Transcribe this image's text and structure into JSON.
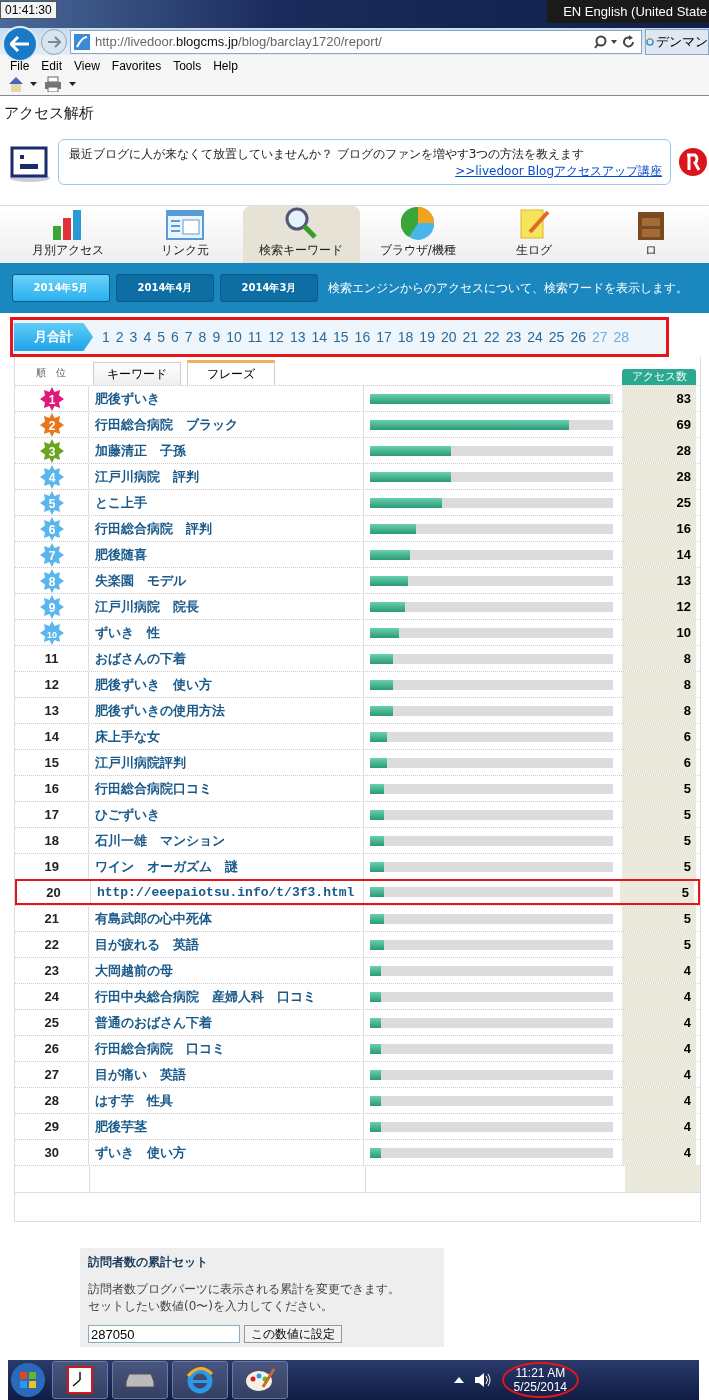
{
  "system_clock": "01:41:30",
  "language_bar": "EN English (United State",
  "address_bar": {
    "url_start": "http://livedoor.",
    "url_domain": "blogcms.jp",
    "url_end": "/blog/barclay1720/report/",
    "tab_title": "デンマン"
  },
  "menu": [
    "File",
    "Edit",
    "View",
    "Favorites",
    "Tools",
    "Help"
  ],
  "page_title": "アクセス解析",
  "banner": {
    "message": "最近ブログに人が来なくて放置していませんか？ ブログのファンを増やす3つの方法を教えます",
    "link": ">>livedoor Blogアクセスアップ講座"
  },
  "nav_tabs": [
    {
      "label": "月別アクセス",
      "selected": false,
      "kind": "bars"
    },
    {
      "label": "リンク元",
      "selected": false,
      "kind": "window"
    },
    {
      "label": "検索キーワード",
      "selected": true,
      "kind": "search"
    },
    {
      "label": "ブラウザ/機種",
      "selected": false,
      "kind": "pie"
    },
    {
      "label": "生ログ",
      "selected": false,
      "kind": "note"
    },
    {
      "label": "ロ",
      "selected": false,
      "kind": "cabinet"
    }
  ],
  "month_tabs": [
    {
      "label": "2014年5月",
      "selected": true
    },
    {
      "label": "2014年4月",
      "selected": false
    },
    {
      "label": "2014年3月",
      "selected": false
    }
  ],
  "month_description": "検索エンジンからのアクセスについて、検索ワードを表示します。",
  "day_selector": {
    "highlighted": true,
    "total_label": "月合計",
    "total_selected": true,
    "days": [
      {
        "label": "1",
        "disabled": false
      },
      {
        "label": "2",
        "disabled": false
      },
      {
        "label": "3",
        "disabled": false
      },
      {
        "label": "4",
        "disabled": false
      },
      {
        "label": "5",
        "disabled": false
      },
      {
        "label": "6",
        "disabled": false
      },
      {
        "label": "7",
        "disabled": false
      },
      {
        "label": "8",
        "disabled": false
      },
      {
        "label": "9",
        "disabled": false
      },
      {
        "label": "10",
        "disabled": false
      },
      {
        "label": "11",
        "disabled": false
      },
      {
        "label": "12",
        "disabled": false
      },
      {
        "label": "13",
        "disabled": false
      },
      {
        "label": "14",
        "disabled": false
      },
      {
        "label": "15",
        "disabled": false
      },
      {
        "label": "16",
        "disabled": false
      },
      {
        "label": "17",
        "disabled": false
      },
      {
        "label": "18",
        "disabled": false
      },
      {
        "label": "19",
        "disabled": false
      },
      {
        "label": "20",
        "disabled": false
      },
      {
        "label": "21",
        "disabled": false
      },
      {
        "label": "22",
        "disabled": false
      },
      {
        "label": "23",
        "disabled": false
      },
      {
        "label": "24",
        "disabled": false
      },
      {
        "label": "25",
        "disabled": false
      },
      {
        "label": "26",
        "disabled": false
      },
      {
        "label": "27",
        "disabled": true
      },
      {
        "label": "28",
        "disabled": true
      }
    ]
  },
  "table": {
    "rank_header": "順　位",
    "count_header": "アクセス数",
    "view_tabs": [
      {
        "label": "キーワード",
        "selected": false
      },
      {
        "label": "フレーズ",
        "selected": true
      }
    ],
    "rows": [
      {
        "rank": "1",
        "color": "#e0187c",
        "phrase": "肥後ずいき",
        "level": 1.0,
        "count": "83",
        "highlighted": false
      },
      {
        "rank": "2",
        "color": "#e8761e",
        "phrase": "行田総合病院　ブラック",
        "level": 0.831,
        "count": "69",
        "highlighted": false
      },
      {
        "rank": "3",
        "color": "#6aa421",
        "phrase": "加藤清正　子孫",
        "level": 0.337,
        "count": "28",
        "highlighted": false
      },
      {
        "rank": "4",
        "color": "#5cb6ee",
        "phrase": "江戸川病院　評判",
        "level": 0.337,
        "count": "28",
        "highlighted": false
      },
      {
        "rank": "5",
        "color": "#5cb6ee",
        "phrase": "とこ上手",
        "level": 0.301,
        "count": "25",
        "highlighted": false
      },
      {
        "rank": "6",
        "color": "#5cb6ee",
        "phrase": "行田総合病院　評判",
        "level": 0.193,
        "count": "16",
        "highlighted": false
      },
      {
        "rank": "7",
        "color": "#5cb6ee",
        "phrase": "肥後随喜",
        "level": 0.169,
        "count": "14",
        "highlighted": false
      },
      {
        "rank": "8",
        "color": "#5cb6ee",
        "phrase": "失楽園　モデル",
        "level": 0.157,
        "count": "13",
        "highlighted": false
      },
      {
        "rank": "9",
        "color": "#5cb6ee",
        "phrase": "江戸川病院　院長",
        "level": 0.145,
        "count": "12",
        "highlighted": false
      },
      {
        "rank": "10",
        "color": "#5cb6ee",
        "phrase": "ずいき　性",
        "level": 0.12,
        "count": "10",
        "highlighted": false
      },
      {
        "rank": "11",
        "phrase": "おばさんの下着",
        "level": 0.096,
        "count": "8",
        "highlighted": false
      },
      {
        "rank": "12",
        "phrase": "肥後ずいき　使い方",
        "level": 0.096,
        "count": "8",
        "highlighted": false
      },
      {
        "rank": "13",
        "phrase": "肥後ずいきの使用方法",
        "level": 0.096,
        "count": "8",
        "highlighted": false
      },
      {
        "rank": "14",
        "phrase": "床上手な女",
        "level": 0.072,
        "count": "6",
        "highlighted": false
      },
      {
        "rank": "15",
        "phrase": "江戸川病院評判",
        "level": 0.072,
        "count": "6",
        "highlighted": false
      },
      {
        "rank": "16",
        "phrase": "行田総合病院口コミ",
        "level": 0.06,
        "count": "5",
        "highlighted": false
      },
      {
        "rank": "17",
        "phrase": "ひごずいき",
        "level": 0.06,
        "count": "5",
        "highlighted": false
      },
      {
        "rank": "18",
        "phrase": "石川一雄　マンション",
        "level": 0.06,
        "count": "5",
        "highlighted": false
      },
      {
        "rank": "19",
        "phrase": "ワイン　オーガズム　謎",
        "level": 0.06,
        "count": "5",
        "highlighted": false
      },
      {
        "rank": "20",
        "phrase": "http://eeepaiotsu.info/t/3f3.html",
        "level": 0.06,
        "count": "5",
        "highlighted": true
      },
      {
        "rank": "21",
        "phrase": "有島武郎の心中死体",
        "level": 0.06,
        "count": "5",
        "highlighted": false
      },
      {
        "rank": "22",
        "phrase": "目が疲れる　英語",
        "level": 0.06,
        "count": "5",
        "highlighted": false
      },
      {
        "rank": "23",
        "phrase": "大岡越前の母",
        "level": 0.048,
        "count": "4",
        "highlighted": false
      },
      {
        "rank": "24",
        "phrase": "行田中央総合病院　産婦人科　口コミ",
        "level": 0.048,
        "count": "4",
        "highlighted": false
      },
      {
        "rank": "25",
        "phrase": "普通のおばさん下着",
        "level": 0.048,
        "count": "4",
        "highlighted": false
      },
      {
        "rank": "26",
        "phrase": "行田総合病院　口コミ",
        "level": 0.048,
        "count": "4",
        "highlighted": false
      },
      {
        "rank": "27",
        "phrase": "目が痛い　英語",
        "level": 0.048,
        "count": "4",
        "highlighted": false
      },
      {
        "rank": "28",
        "phrase": "はす芋　性具",
        "level": 0.048,
        "count": "4",
        "highlighted": false
      },
      {
        "rank": "29",
        "phrase": "肥後芋茎",
        "level": 0.048,
        "count": "4",
        "highlighted": false
      },
      {
        "rank": "30",
        "phrase": "ずいき　使い方",
        "level": 0.048,
        "count": "4",
        "highlighted": false
      }
    ]
  },
  "counter_box": {
    "title": "訪問者数の累計セット",
    "description_1": "訪問者数ブログパーツに表示される累計を変更できます。",
    "description_2": "セットしたい数値(0〜)を入力してください。",
    "value": "287050",
    "button": "この数値に設定"
  },
  "taskbar": {
    "time": "11:21 AM",
    "date": "5/25/2014",
    "clock_circled": true
  }
}
